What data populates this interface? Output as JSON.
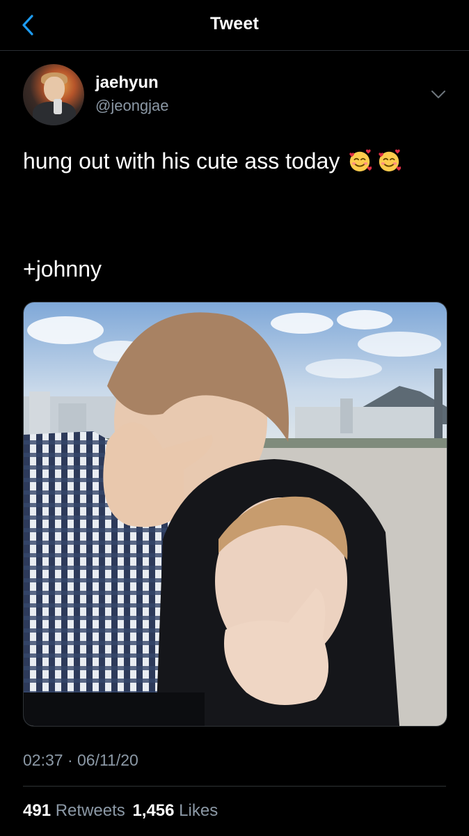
{
  "header": {
    "title": "Tweet",
    "back_icon": "chevron-left-icon",
    "accent_color": "#1d9bf0"
  },
  "author": {
    "display_name": "jaehyun",
    "handle": "@jeongjae",
    "more_icon": "chevron-down-icon"
  },
  "tweet": {
    "text_line1": "hung out with his cute ass today",
    "emojis": [
      "smiling-face-with-hearts-emoji",
      "smiling-face-with-hearts-emoji"
    ],
    "text_line2": "+johnny"
  },
  "meta": {
    "timestamp": "02:37 · 06/11/20"
  },
  "stats": {
    "retweets_count": "491",
    "retweets_label": "Retweets",
    "likes_count": "1,456",
    "likes_label": "Likes"
  },
  "colors": {
    "background": "#000000",
    "secondary_text": "#8b98a5",
    "divider": "#2f3336"
  }
}
